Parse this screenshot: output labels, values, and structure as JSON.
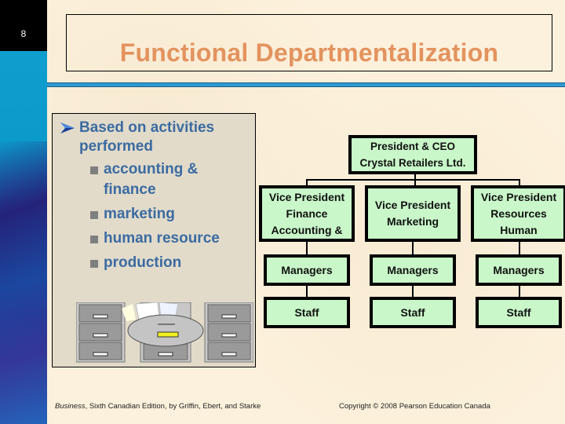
{
  "slide": {
    "page_number": "8",
    "title": "Functional Departmentalization"
  },
  "bullets": {
    "main": "Based on activities performed",
    "items": [
      {
        "label": "accounting & finance"
      },
      {
        "label": "marketing"
      },
      {
        "label": "human resource"
      },
      {
        "label": "production"
      }
    ]
  },
  "org_chart": {
    "top": {
      "line1": "President & CEO",
      "line2": "Crystal Retailers Ltd."
    },
    "vps": [
      {
        "line1": "Vice President",
        "line2": "Finance",
        "line3": "Accounting &"
      },
      {
        "line1": "Vice President",
        "line2": "Marketing",
        "line3": ""
      },
      {
        "line1": "Vice President",
        "line2": "Resources",
        "line3": "Human"
      }
    ],
    "managers": [
      "Managers",
      "Managers",
      "Managers"
    ],
    "staff": [
      "Staff",
      "Staff",
      "Staff"
    ]
  },
  "footer": {
    "book_italic": "Business",
    "book_rest": ", Sixth Canadian Edition, by Griffin, Ebert, and Starke",
    "copyright": "Copyright © 2008 Pearson Education Canada"
  },
  "colors": {
    "title": "#e3935f",
    "bullet_text": "#3b6ba1",
    "org_box_fill": "#c9f7c9",
    "accent_bar": "#2e9bd1",
    "background": "#fcf1dc"
  }
}
